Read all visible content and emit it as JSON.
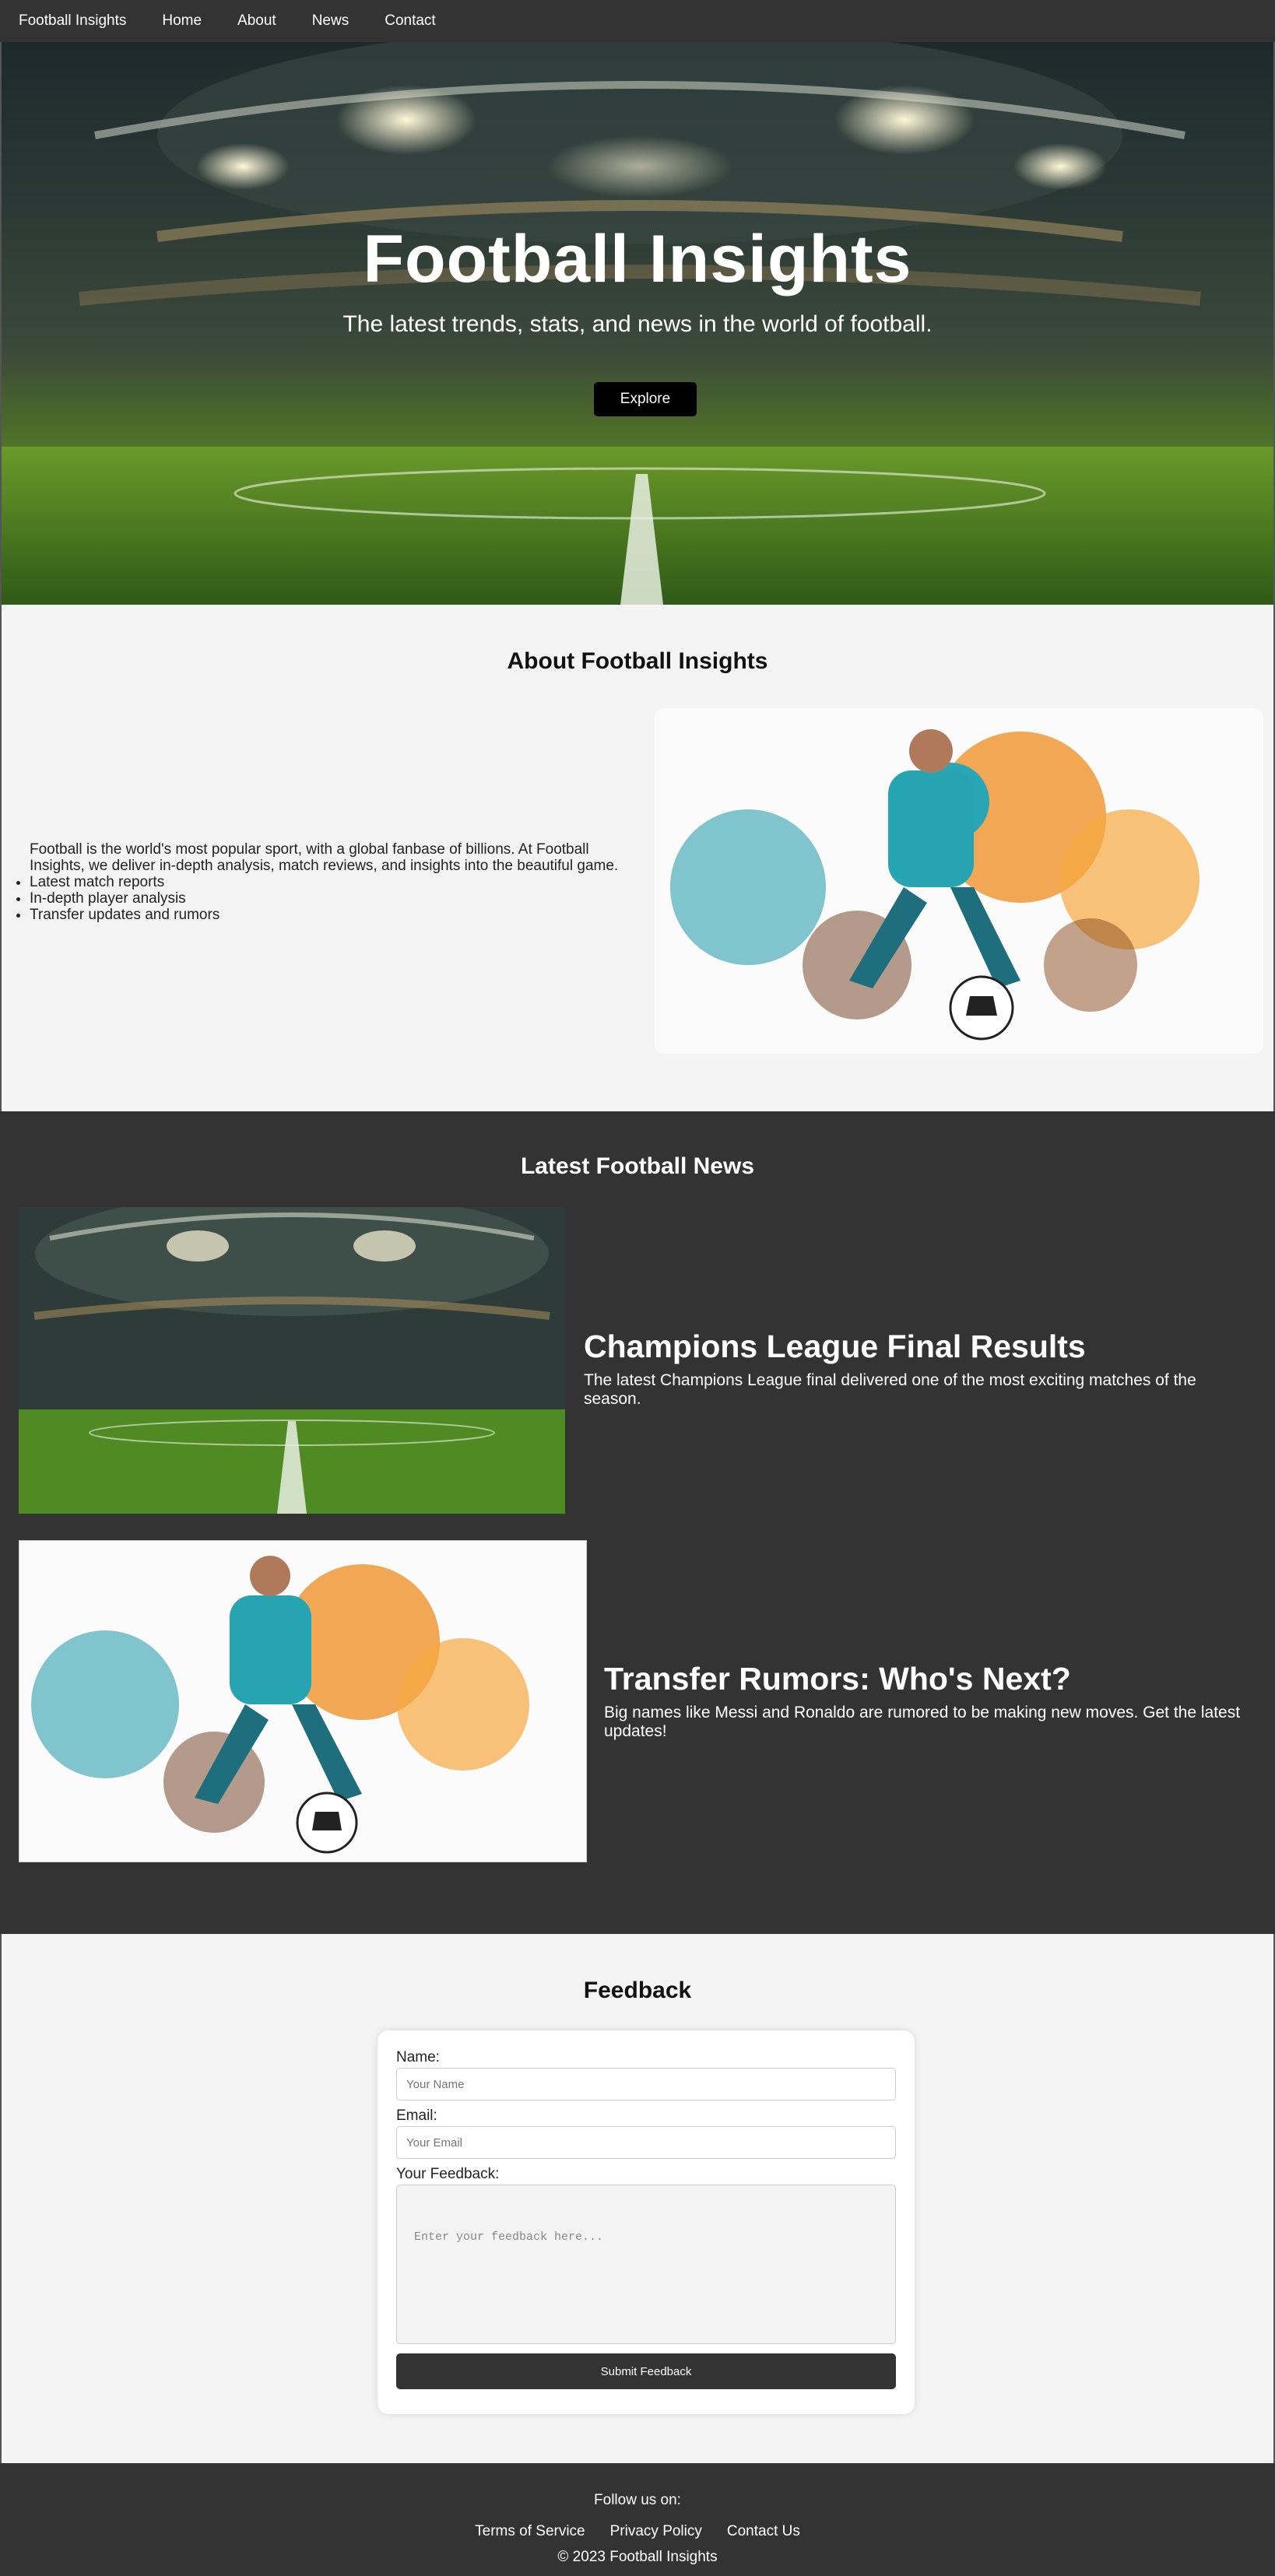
{
  "nav": {
    "brand": "Football Insights",
    "items": [
      "Home",
      "About",
      "News",
      "Contact"
    ]
  },
  "hero": {
    "title": "Football Insights",
    "subtitle": "The latest trends, stats, and news in the world of football.",
    "button": "Explore"
  },
  "about": {
    "title": "About Football Insights",
    "paragraph": "Football is the world's most popular sport, with a global fanbase of billions. At Football Insights, we deliver in-depth analysis, match reviews, and insights into the beautiful game.",
    "list": [
      "Latest match reports",
      "In-depth player analysis",
      "Transfer updates and rumors"
    ]
  },
  "news": {
    "title": "Latest Football News",
    "articles": [
      {
        "headline": "Champions League Final Results",
        "text": "The latest Champions League final delivered one of the most exciting matches of the season."
      },
      {
        "headline": "Transfer Rumors: Who's Next?",
        "text": "Big names like Messi and Ronaldo are rumored to be making new moves. Get the latest updates!"
      }
    ]
  },
  "feedback": {
    "title": "Feedback",
    "name_label": "Name:",
    "name_placeholder": "Your Name",
    "email_label": "Email:",
    "email_placeholder": "Your Email",
    "feedback_label": "Your Feedback:",
    "feedback_placeholder": "Enter your feedback here...",
    "submit": "Submit Feedback"
  },
  "footer": {
    "follow": "Follow us on:",
    "links": [
      "Terms of Service",
      "Privacy Policy",
      "Contact Us"
    ],
    "copyright": "© 2023 Football Insights"
  },
  "colors": {
    "nav_bg": "#333333",
    "page_bg": "#f4f4f4",
    "button_dark": "#000000",
    "accent_orange": "#f0922a",
    "accent_teal": "#2fa0b0"
  }
}
